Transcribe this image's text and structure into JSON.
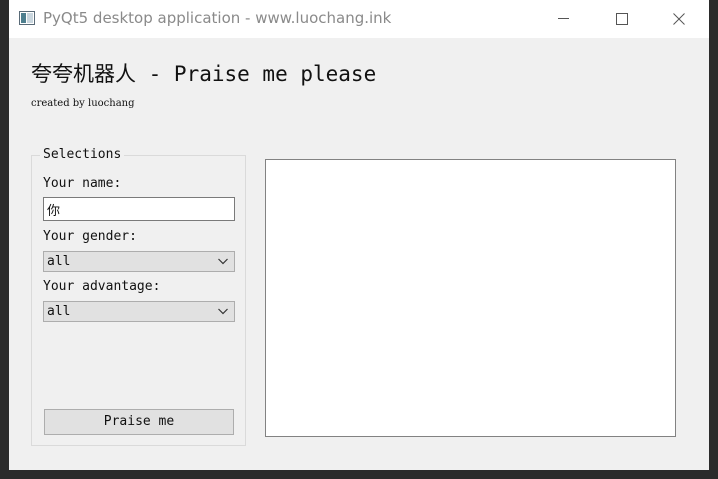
{
  "window": {
    "title": "PyQt5 desktop application - www.luochang.ink",
    "icon": "app-window-icon",
    "controls": {
      "minimize_icon": "minimize-icon",
      "maximize_icon": "maximize-icon",
      "close_icon": "close-icon"
    }
  },
  "header": {
    "title": "夸夸机器人 - Praise me please",
    "subtitle": "created by luochang"
  },
  "selections": {
    "group_title": "Selections",
    "name_label": "Your name:",
    "name_value": "你",
    "gender_label": "Your gender:",
    "gender_value": "all",
    "advantage_label": "Your advantage:",
    "advantage_value": "all",
    "praise_button": "Praise me"
  },
  "output": {
    "text": ""
  }
}
